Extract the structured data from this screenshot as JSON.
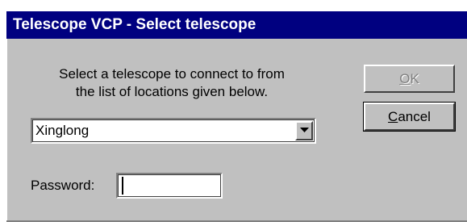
{
  "window": {
    "title": "Telescope VCP - Select telescope"
  },
  "instructions": {
    "line1": "Select a telescope to connect to from",
    "line2": "the list of locations given below."
  },
  "telescope_select": {
    "selected": "Xinglong"
  },
  "password": {
    "label": "Password:",
    "value": ""
  },
  "buttons": {
    "ok": {
      "mnemonic": "O",
      "rest": "K",
      "enabled": false
    },
    "cancel": {
      "mnemonic": "C",
      "rest": "ancel",
      "enabled": true
    }
  },
  "colors": {
    "titlebar": "#000080",
    "dialog_face": "#c0c0c0"
  },
  "icons": {
    "dropdown": "chevron-down-icon"
  }
}
